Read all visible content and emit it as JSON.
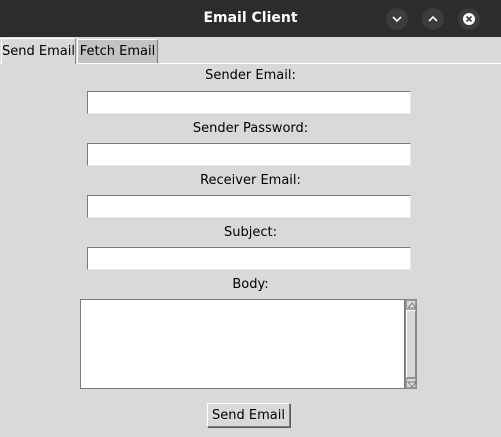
{
  "window": {
    "title": "Email Client"
  },
  "tabs": [
    {
      "label": "Send Email",
      "active": true
    },
    {
      "label": "Fetch Email",
      "active": false
    }
  ],
  "form": {
    "sender_email": {
      "label": "Sender Email:",
      "value": ""
    },
    "sender_password": {
      "label": "Sender Password:",
      "value": ""
    },
    "receiver_email": {
      "label": "Receiver Email:",
      "value": ""
    },
    "subject": {
      "label": "Subject:",
      "value": ""
    },
    "body": {
      "label": "Body:",
      "value": ""
    },
    "send_label": "Send Email"
  },
  "icons": {
    "minimize": "chevron-down-icon",
    "maximize": "chevron-up-icon",
    "close": "close-icon"
  }
}
